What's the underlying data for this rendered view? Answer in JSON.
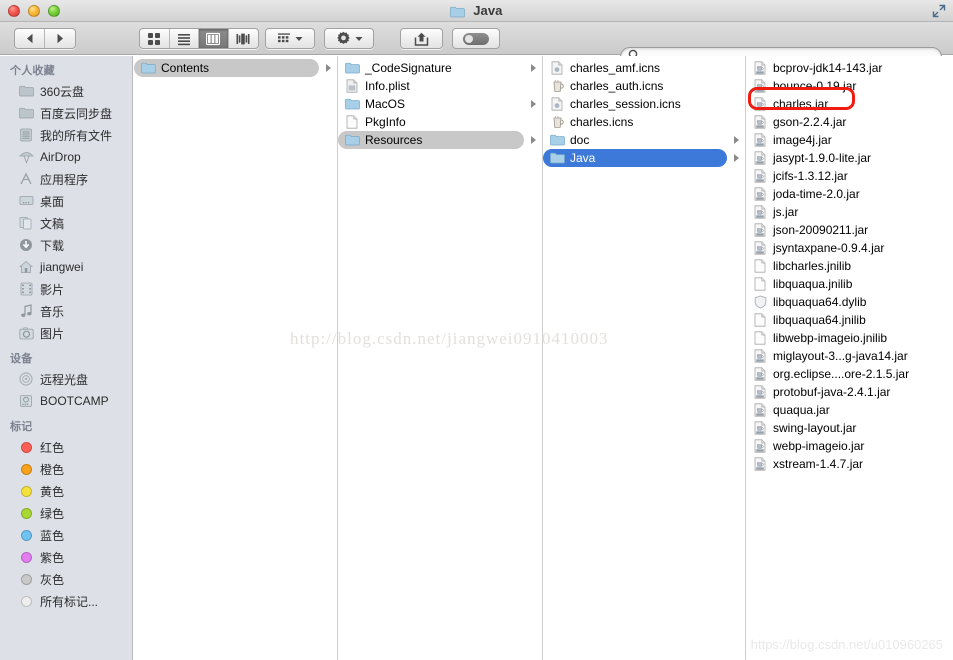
{
  "window": {
    "title": "Java",
    "traffic_lights": [
      "close-button",
      "minimize-button",
      "maximize-button"
    ],
    "fullscreen_label": "Full Screen"
  },
  "toolbar": {
    "back_label": "Back",
    "forward_label": "Forward",
    "view_icon_label": "Icon View",
    "view_list_label": "List View",
    "view_column_label": "Column View",
    "view_coverflow_label": "Cover Flow View",
    "arrange_label": "Arrange",
    "action_label": "Action",
    "share_label": "Share",
    "tags_label": "Edit Tags",
    "active_view": "column"
  },
  "search": {
    "value": "",
    "placeholder": ""
  },
  "sidebar": {
    "sections": [
      {
        "title": "个人收藏",
        "items": [
          {
            "label": "360云盘",
            "icon": "folder-icon"
          },
          {
            "label": "百度云同步盘",
            "icon": "folder-icon"
          },
          {
            "label": "我的所有文件",
            "icon": "all-files-icon"
          },
          {
            "label": "AirDrop",
            "icon": "airdrop-icon"
          },
          {
            "label": "应用程序",
            "icon": "applications-icon"
          },
          {
            "label": "桌面",
            "icon": "desktop-icon"
          },
          {
            "label": "文稿",
            "icon": "documents-icon"
          },
          {
            "label": "下载",
            "icon": "downloads-icon"
          },
          {
            "label": "jiangwei",
            "icon": "home-icon"
          },
          {
            "label": "影片",
            "icon": "movies-icon"
          },
          {
            "label": "音乐",
            "icon": "music-icon"
          },
          {
            "label": "图片",
            "icon": "pictures-icon"
          }
        ]
      },
      {
        "title": "设备",
        "items": [
          {
            "label": "远程光盘",
            "icon": "remote-disc-icon"
          },
          {
            "label": "BOOTCAMP",
            "icon": "hard-drive-icon"
          }
        ]
      },
      {
        "title": "标记",
        "items": [
          {
            "label": "红色",
            "icon": "tag-dot-icon",
            "color": "#ff5f56"
          },
          {
            "label": "橙色",
            "icon": "tag-dot-icon",
            "color": "#f9a21b"
          },
          {
            "label": "黄色",
            "icon": "tag-dot-icon",
            "color": "#f5e13c"
          },
          {
            "label": "绿色",
            "icon": "tag-dot-icon",
            "color": "#a8d833"
          },
          {
            "label": "蓝色",
            "icon": "tag-dot-icon",
            "color": "#6fc3f2"
          },
          {
            "label": "紫色",
            "icon": "tag-dot-icon",
            "color": "#e47df0"
          },
          {
            "label": "灰色",
            "icon": "tag-dot-icon",
            "color": "#c9c9c9"
          },
          {
            "label": "所有标记...",
            "icon": "all-tags-icon",
            "color": "#eeeeee"
          }
        ]
      }
    ]
  },
  "columns": [
    {
      "name": "column-1",
      "items": [
        {
          "label": "Contents",
          "icon": "folder-icon",
          "has_arrow": true,
          "state": "selected-inactive"
        }
      ]
    },
    {
      "name": "column-2",
      "items": [
        {
          "label": "_CodeSignature",
          "icon": "folder-icon",
          "has_arrow": true,
          "state": "normal"
        },
        {
          "label": "Info.plist",
          "icon": "plist-file-icon",
          "has_arrow": false,
          "state": "normal"
        },
        {
          "label": "MacOS",
          "icon": "folder-icon",
          "has_arrow": true,
          "state": "normal"
        },
        {
          "label": "PkgInfo",
          "icon": "blank-file-icon",
          "has_arrow": false,
          "state": "normal"
        },
        {
          "label": "Resources",
          "icon": "folder-icon",
          "has_arrow": true,
          "state": "selected-inactive"
        }
      ]
    },
    {
      "name": "column-3",
      "items": [
        {
          "label": "charles_amf.icns",
          "icon": "icns-file-icon",
          "has_arrow": false,
          "state": "normal"
        },
        {
          "label": "charles_auth.icns",
          "icon": "charles-icon",
          "has_arrow": false,
          "state": "normal"
        },
        {
          "label": "charles_session.icns",
          "icon": "icns-file-icon",
          "has_arrow": false,
          "state": "normal"
        },
        {
          "label": "charles.icns",
          "icon": "charles-icon",
          "has_arrow": false,
          "state": "normal"
        },
        {
          "label": "doc",
          "icon": "folder-icon",
          "has_arrow": true,
          "state": "normal"
        },
        {
          "label": "Java",
          "icon": "folder-icon",
          "has_arrow": true,
          "state": "selected-active"
        }
      ]
    },
    {
      "name": "column-4",
      "items": [
        {
          "label": "bcprov-jdk14-143.jar",
          "icon": "jar-file-icon",
          "has_arrow": false,
          "state": "normal"
        },
        {
          "label": "bounce-0.19.jar",
          "icon": "jar-file-icon",
          "has_arrow": false,
          "state": "normal"
        },
        {
          "label": "charles.jar",
          "icon": "jar-file-icon",
          "has_arrow": false,
          "state": "normal",
          "annotated": true
        },
        {
          "label": "gson-2.2.4.jar",
          "icon": "jar-file-icon",
          "has_arrow": false,
          "state": "normal"
        },
        {
          "label": "image4j.jar",
          "icon": "jar-file-icon",
          "has_arrow": false,
          "state": "normal"
        },
        {
          "label": "jasypt-1.9.0-lite.jar",
          "icon": "jar-file-icon",
          "has_arrow": false,
          "state": "normal"
        },
        {
          "label": "jcifs-1.3.12.jar",
          "icon": "jar-file-icon",
          "has_arrow": false,
          "state": "normal"
        },
        {
          "label": "joda-time-2.0.jar",
          "icon": "jar-file-icon",
          "has_arrow": false,
          "state": "normal"
        },
        {
          "label": "js.jar",
          "icon": "jar-file-icon",
          "has_arrow": false,
          "state": "normal"
        },
        {
          "label": "json-20090211.jar",
          "icon": "jar-file-icon",
          "has_arrow": false,
          "state": "normal"
        },
        {
          "label": "jsyntaxpane-0.9.4.jar",
          "icon": "jar-file-icon",
          "has_arrow": false,
          "state": "normal"
        },
        {
          "label": "libcharles.jnilib",
          "icon": "blank-file-icon",
          "has_arrow": false,
          "state": "normal"
        },
        {
          "label": "libquaqua.jnilib",
          "icon": "blank-file-icon",
          "has_arrow": false,
          "state": "normal"
        },
        {
          "label": "libquaqua64.dylib",
          "icon": "dylib-file-icon",
          "has_arrow": false,
          "state": "normal"
        },
        {
          "label": "libquaqua64.jnilib",
          "icon": "blank-file-icon",
          "has_arrow": false,
          "state": "normal"
        },
        {
          "label": "libwebp-imageio.jnilib",
          "icon": "blank-file-icon",
          "has_arrow": false,
          "state": "normal"
        },
        {
          "label": "miglayout-3...g-java14.jar",
          "icon": "jar-file-icon",
          "has_arrow": false,
          "state": "normal"
        },
        {
          "label": "org.eclipse....ore-2.1.5.jar",
          "icon": "jar-file-icon",
          "has_arrow": false,
          "state": "normal"
        },
        {
          "label": "protobuf-java-2.4.1.jar",
          "icon": "jar-file-icon",
          "has_arrow": false,
          "state": "normal"
        },
        {
          "label": "quaqua.jar",
          "icon": "jar-file-icon",
          "has_arrow": false,
          "state": "normal"
        },
        {
          "label": "swing-layout.jar",
          "icon": "jar-file-icon",
          "has_arrow": false,
          "state": "normal"
        },
        {
          "label": "webp-imageio.jar",
          "icon": "jar-file-icon",
          "has_arrow": false,
          "state": "normal"
        },
        {
          "label": "xstream-1.4.7.jar",
          "icon": "jar-file-icon",
          "has_arrow": false,
          "state": "normal"
        }
      ]
    }
  ],
  "annotation": {
    "color": "#ee1c11",
    "target": "charles.jar"
  },
  "watermarks": {
    "center": "http://blog.csdn.net/jiangwei0910410003",
    "corner": "https://blog.csdn.net/u010960265"
  }
}
